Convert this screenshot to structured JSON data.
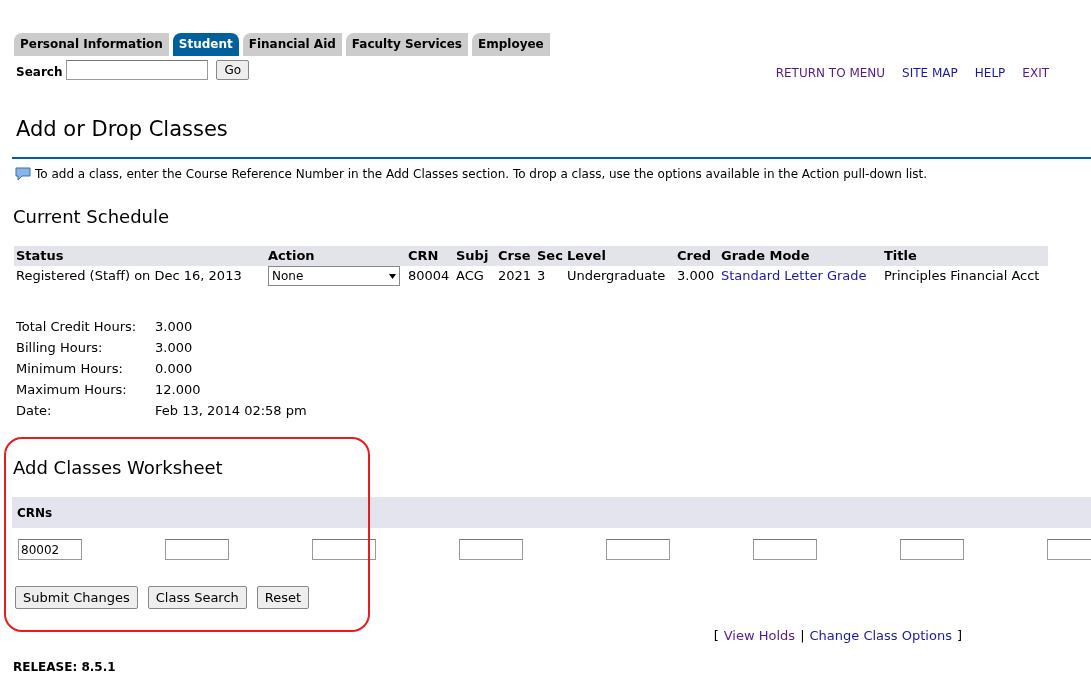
{
  "tabs": [
    {
      "label": "Personal Information",
      "selected": false
    },
    {
      "label": "Student",
      "selected": true
    },
    {
      "label": "Financial Aid",
      "selected": false
    },
    {
      "label": "Faculty Services",
      "selected": false
    },
    {
      "label": "Employee",
      "selected": false
    }
  ],
  "search": {
    "label": "Search",
    "button": "Go"
  },
  "top_links": [
    {
      "label": "RETURN TO MENU",
      "visited": true
    },
    {
      "label": "SITE MAP",
      "visited": false
    },
    {
      "label": "HELP",
      "visited": false
    },
    {
      "label": "EXIT",
      "visited": true
    }
  ],
  "page_title": "Add or Drop Classes",
  "info_text": "To add a class, enter the Course Reference Number in the Add Classes section. To drop a class, use the options available in the Action pull-down list.",
  "current_schedule": {
    "heading": "Current Schedule",
    "columns": [
      "Status",
      "Action",
      "CRN",
      "Subj",
      "Crse",
      "Sec",
      "Level",
      "Cred",
      "Grade Mode",
      "Title"
    ],
    "rows": [
      {
        "status": "Registered (Staff) on Dec 16, 2013",
        "action": "None",
        "crn": "80004",
        "subj": "ACG",
        "crse": "2021",
        "sec": "3",
        "level": "Undergraduate",
        "cred": "3.000",
        "grade_mode": "Standard Letter Grade",
        "title": "Principles Financial Acct"
      }
    ]
  },
  "totals": [
    {
      "label": "Total Credit Hours:",
      "value": "3.000"
    },
    {
      "label": "Billing Hours:",
      "value": "3.000"
    },
    {
      "label": "Minimum Hours:",
      "value": "0.000"
    },
    {
      "label": "Maximum Hours:",
      "value": "12.000"
    },
    {
      "label": "Date:",
      "value": "Feb 13, 2014 02:58 pm"
    }
  ],
  "worksheet": {
    "heading": "Add Classes Worksheet",
    "crn_header": "CRNs",
    "crn_fields": [
      {
        "kind": "filled",
        "value": "80002"
      },
      {
        "kind": "empty"
      },
      {
        "kind": "empty"
      },
      {
        "kind": "empty"
      },
      {
        "kind": "empty"
      },
      {
        "kind": "empty"
      },
      {
        "kind": "empty"
      },
      {
        "kind": "empty"
      }
    ],
    "buttons": [
      "Submit Changes",
      "Class Search",
      "Reset"
    ]
  },
  "bottom_links": {
    "open": "[",
    "separator": "|",
    "close": "]",
    "links": [
      {
        "label": "View Holds",
        "visited": true
      },
      {
        "label": "Change Class Options",
        "visited": false
      }
    ]
  },
  "release": "RELEASE: 8.5.1"
}
